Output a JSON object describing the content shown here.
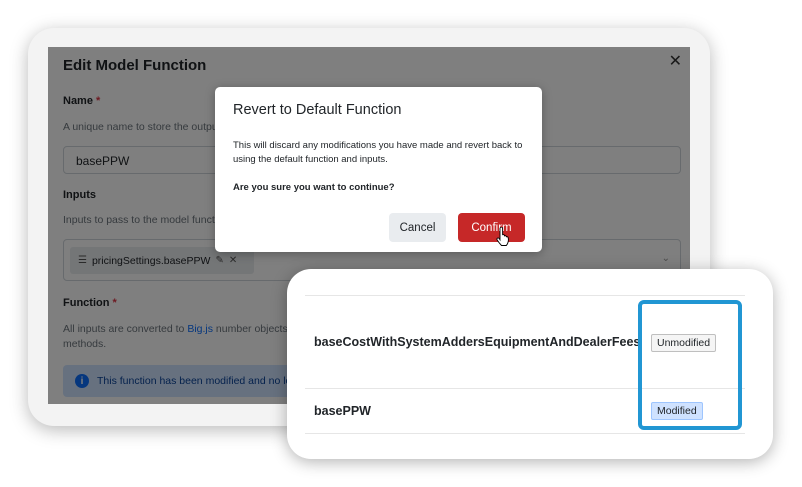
{
  "edit_modal": {
    "title": "Edit Model Function",
    "close_glyph": "✕",
    "name_label": "Name",
    "required_mark": "*",
    "name_help": "A unique name to store the output of the function",
    "name_value": "basePPW",
    "inputs_label": "Inputs",
    "inputs_help": "Inputs to pass to the model function",
    "input_chip": "pricingSettings.basePPW",
    "function_label": "Function",
    "function_help_pre": "All inputs are converted to ",
    "function_help_link": "Big.js",
    "function_help_post": " number objects before being passed to the function.",
    "function_help_line2": "methods.",
    "alert_text": "This function has been modified and no longer matches the default function."
  },
  "revert_dialog": {
    "title": "Revert to Default Function",
    "body": "This will discard any modifications you have made and revert back to using the default function and inputs.",
    "question": "Are you sure you want to continue?",
    "cancel_label": "Cancel",
    "confirm_label": "Confirm"
  },
  "zoom_table": {
    "rows": [
      {
        "name": "baseCostWithSystemAddersEquipmentAndDealerFees",
        "status": "Unmodified"
      },
      {
        "name": "basePPW",
        "status": "Modified"
      }
    ]
  },
  "colors": {
    "confirm": "#c62828",
    "highlight": "#2196d3",
    "modified_badge": "#cfe2ff"
  }
}
